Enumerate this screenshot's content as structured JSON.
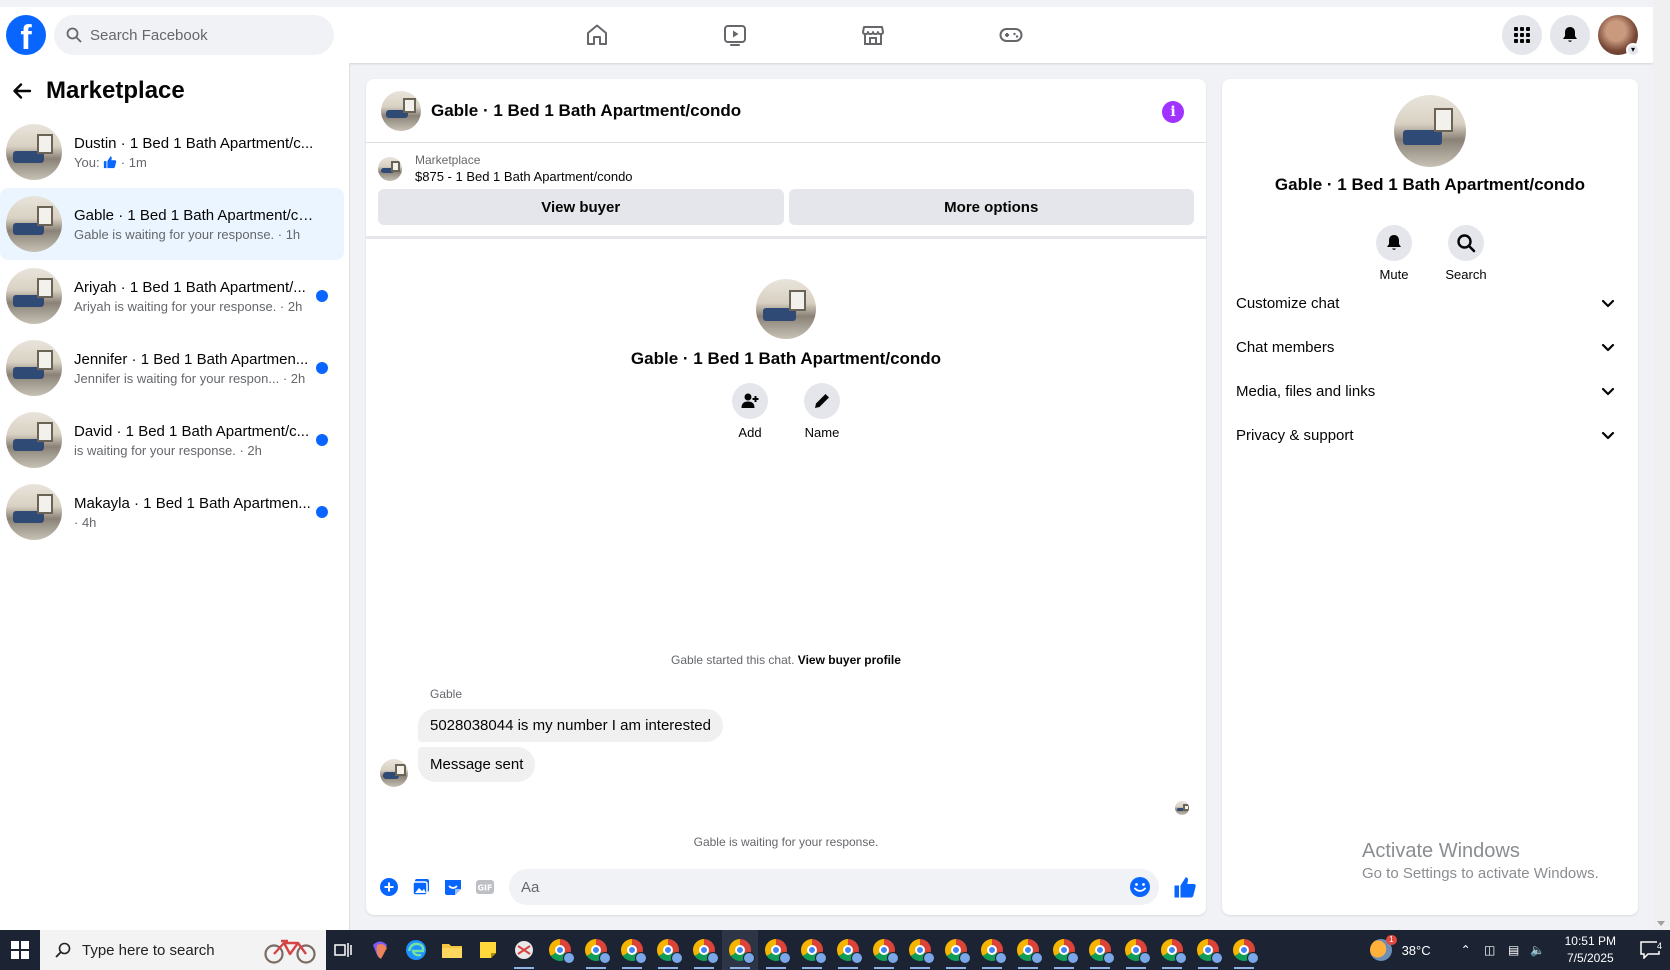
{
  "topbar": {
    "logo": "f",
    "search_placeholder": "Search Facebook",
    "nav_icons": [
      "home-icon",
      "video-icon",
      "marketplace-icon",
      "gaming-icon"
    ],
    "right_icons": [
      "menu-grid-icon",
      "bell-icon",
      "account-avatar"
    ]
  },
  "sidebar": {
    "title": "Marketplace",
    "conversations": [
      {
        "name": "Dustin · 1 Bed 1 Bath Apartment/c...",
        "sub_prefix": "You: ",
        "sub": " · 1m",
        "unread": false,
        "active": false,
        "like": true
      },
      {
        "name": "Gable · 1 Bed 1 Bath Apartment/co...",
        "sub": "Gable is waiting for your response. · 1h",
        "unread": false,
        "active": true
      },
      {
        "name": "Ariyah · 1 Bed 1 Bath Apartment/...",
        "sub": "Ariyah is waiting for your response. · 2h",
        "unread": true,
        "active": false
      },
      {
        "name": "Jennifer · 1 Bed 1 Bath Apartmen...",
        "sub": "Jennifer is waiting for your respon... · 2h",
        "unread": true,
        "active": false
      },
      {
        "name": "David · 1 Bed 1 Bath Apartment/c...",
        "sub": "is waiting for your response. · 2h",
        "unread": true,
        "active": false
      },
      {
        "name": "Makayla · 1 Bed 1 Bath Apartmen...",
        "sub": " · 4h",
        "unread": true,
        "active": false
      }
    ]
  },
  "chat": {
    "title": "Gable · 1 Bed 1 Bath Apartment/condo",
    "marketplace_label": "Marketplace",
    "listing": "$875 - 1 Bed 1 Bath Apartment/condo",
    "view_buyer_label": "View buyer",
    "more_options_label": "More options",
    "intro_name": "Gable · 1 Bed 1 Bath Apartment/condo",
    "add_label": "Add",
    "name_label": "Name",
    "started_text": "Gable started this chat. ",
    "view_profile_label": "View buyer profile",
    "sender": "Gable",
    "messages": [
      "5028038044 is my number I am interested",
      "Message sent"
    ],
    "waiting_text": "Gable is waiting for your response.",
    "input_placeholder": "Aa"
  },
  "info_panel": {
    "name": "Gable · 1 Bed 1 Bath Apartment/condo",
    "mute_label": "Mute",
    "search_label": "Search",
    "sections": [
      "Customize chat",
      "Chat members",
      "Media, files and links",
      "Privacy & support"
    ]
  },
  "watermark": {
    "line1": "Activate Windows",
    "line2": "Go to Settings to activate Windows."
  },
  "taskbar": {
    "search_placeholder": "Type here to search",
    "temperature": "38°C",
    "weather_badge": "1",
    "time": "10:51 PM",
    "date": "7/5/2025",
    "notification_count": "4"
  },
  "colors": {
    "facebook_blue": "#0866ff",
    "messenger_purple": "#a033ff",
    "active_row": "#ebf5ff",
    "taskbar": "#1c2333"
  }
}
